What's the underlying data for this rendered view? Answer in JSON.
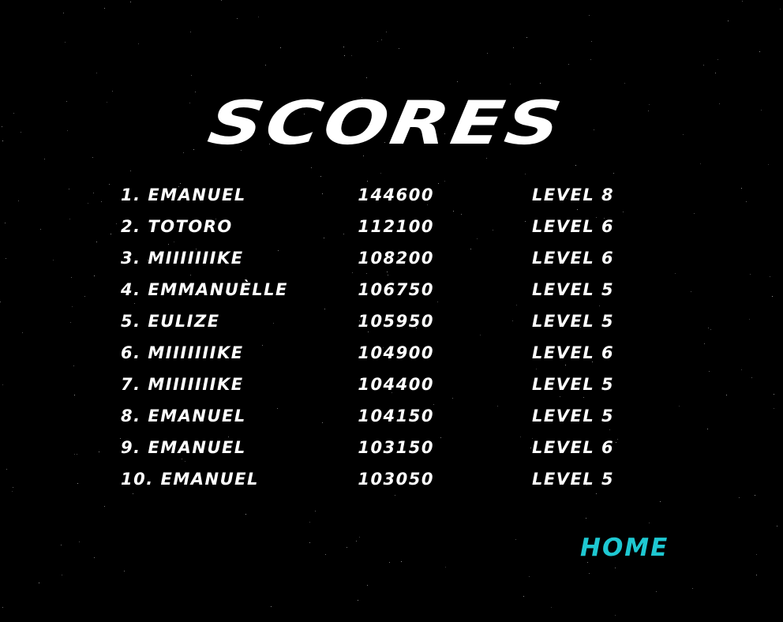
{
  "title": "SCORES",
  "home_label": "HOME",
  "colors": {
    "background": "#000000",
    "text": "#ffffff",
    "home": "#1ec8d2",
    "star": "#9a9a9a"
  },
  "scores": [
    {
      "rank": "1.",
      "name": "EMANUEL",
      "score": "144600",
      "level": "LEVEL 8"
    },
    {
      "rank": "2.",
      "name": "TOTORO",
      "score": "112100",
      "level": "LEVEL 6"
    },
    {
      "rank": "3.",
      "name": "MIIIIIIIKE",
      "score": "108200",
      "level": "LEVEL 6"
    },
    {
      "rank": "4.",
      "name": "EMMANUÈLLE",
      "score": "106750",
      "level": "LEVEL 5"
    },
    {
      "rank": "5.",
      "name": "EULIZE",
      "score": "105950",
      "level": "LEVEL 5"
    },
    {
      "rank": "6.",
      "name": "MIIIIIIIKE",
      "score": "104900",
      "level": "LEVEL 6"
    },
    {
      "rank": "7.",
      "name": "MIIIIIIIKE",
      "score": "104400",
      "level": "LEVEL 5"
    },
    {
      "rank": "8.",
      "name": "EMANUEL",
      "score": "104150",
      "level": "LEVEL 5"
    },
    {
      "rank": "9.",
      "name": "EMANUEL",
      "score": "103150",
      "level": "LEVEL 6"
    },
    {
      "rank": "10.",
      "name": "EMANUEL",
      "score": "103050",
      "level": "LEVEL 5"
    }
  ]
}
